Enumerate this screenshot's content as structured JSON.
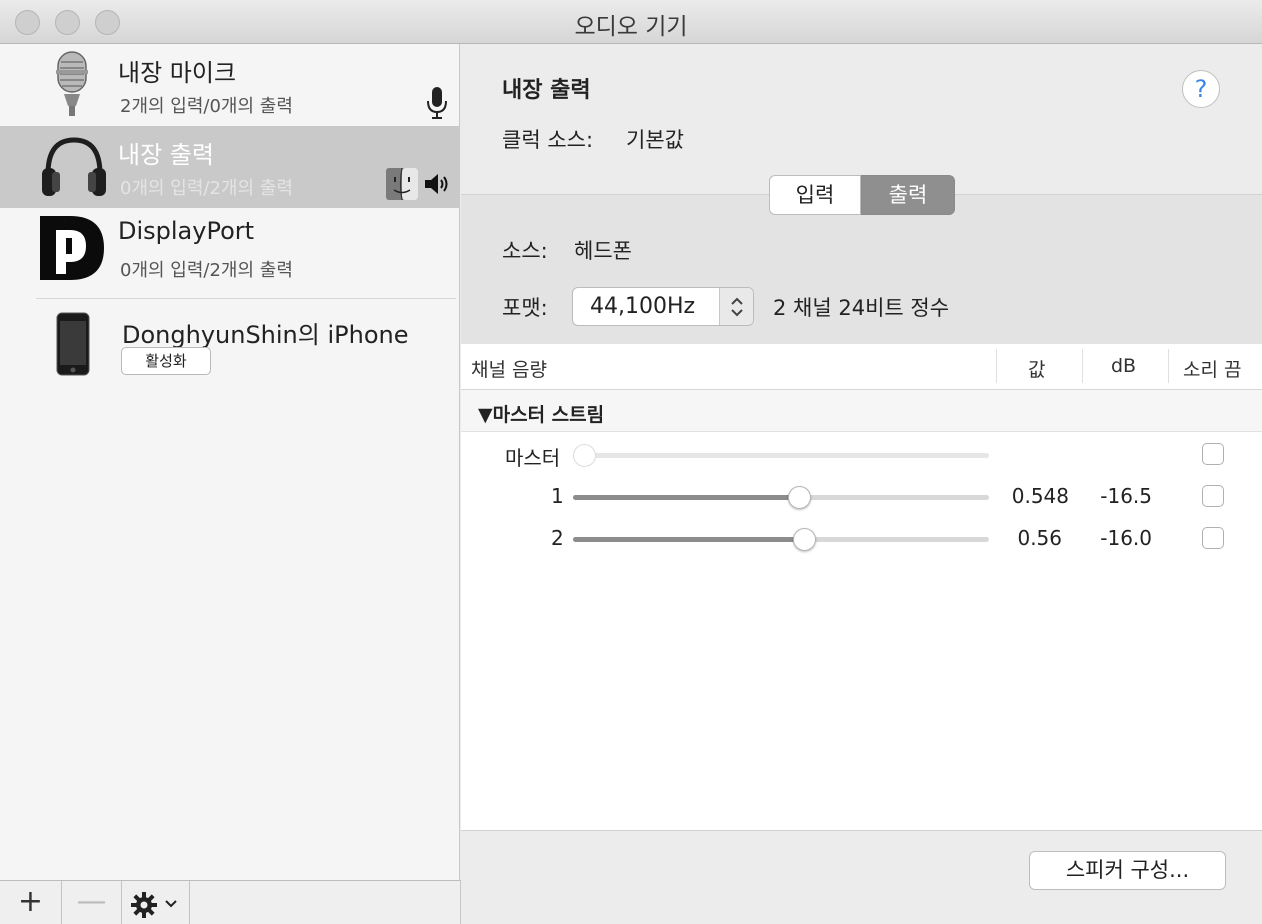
{
  "window": {
    "title": "오디오 기기"
  },
  "sidebar": {
    "devices": [
      {
        "name": "내장 마이크",
        "sub": "2개의 입력/0개의 출력",
        "icon": "microphone-icon"
      },
      {
        "name": "내장 출력",
        "sub": "0개의 입력/2개의 출력",
        "icon": "headphones-icon",
        "selected": true
      },
      {
        "name": "DisplayPort",
        "sub": "0개의 입력/2개의 출력",
        "icon": "displayport-icon"
      },
      {
        "name": "DonghyunShin의 iPhone",
        "sub": "",
        "icon": "iphone-icon",
        "button": "활성화"
      }
    ],
    "bottom": {
      "add": "+",
      "remove": "—"
    }
  },
  "detail": {
    "title": "내장 출력",
    "clock_label": "클럭 소스:",
    "clock_value": "기본값",
    "tabs": [
      "입력",
      "출력"
    ],
    "active_tab": "출력",
    "source_label": "소스:",
    "source_value": "헤드폰",
    "format_label": "포맷:",
    "format_value": "44,100Hz",
    "format_desc": "2 채널 24비트 정수",
    "table": {
      "headers": {
        "channel": "채널 음량",
        "value": "값",
        "db": "dB",
        "mute": "소리 끔"
      },
      "group": "▼마스터 스트림",
      "rows": [
        {
          "label": "마스터",
          "value": "",
          "db": "",
          "level": 0.0,
          "enabled": false
        },
        {
          "label": "1",
          "value": "0.548",
          "db": "-16.5",
          "level": 0.548,
          "enabled": true
        },
        {
          "label": "2",
          "value": "0.56",
          "db": "-16.0",
          "level": 0.56,
          "enabled": true
        }
      ]
    },
    "speaker_button": "스피커 구성..."
  }
}
